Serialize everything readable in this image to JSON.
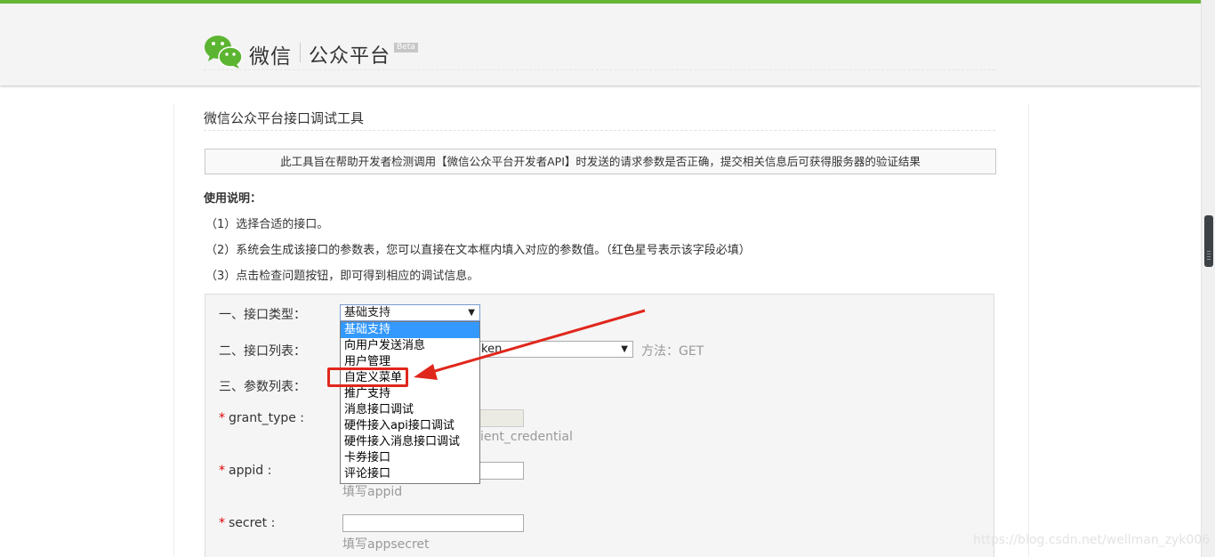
{
  "header": {
    "brand": "微信",
    "brand_sub": "公众平台",
    "beta": "Beta"
  },
  "page": {
    "title": "微信公众平台接口调试工具",
    "notice": "此工具旨在帮助开发者检测调用【微信公众平台开发者API】时发送的请求参数是否正确，提交相关信息后可获得服务器的验证结果",
    "usage_title": "使用说明：",
    "usage_items": [
      "（1）选择合适的接口。",
      "（2）系统会生成该接口的参数表，您可以直接在文本框内填入对应的参数值。（红色星号表示该字段必填）",
      "（3）点击检查问题按钮，即可得到相应的调试信息。"
    ]
  },
  "form": {
    "type_label": "一、接口类型：",
    "type_value": "基础支持",
    "list_label": "二、接口列表：",
    "list_value_partial": "ken",
    "method": "方法：GET",
    "params_label": "三、参数列表：",
    "params": [
      {
        "name": "grant_type :",
        "required": "*",
        "hint_partial": "ient_credential"
      },
      {
        "name": "appid :",
        "required": "*",
        "hint": "填写appid"
      },
      {
        "name": "secret :",
        "required": "*",
        "hint": "填写appsecret"
      }
    ]
  },
  "dropdown": {
    "options": [
      "基础支持",
      "向用户发送消息",
      "用户管理",
      "自定义菜单",
      "推广支持",
      "消息接口调试",
      "硬件接入api接口调试",
      "硬件接入消息接口调试",
      "卡券接口",
      "评论接口"
    ],
    "selected_index": 0,
    "highlighted_option": "自定义菜单"
  },
  "annotation_color": "#e0271c",
  "brand_color": "#66b535",
  "watermark": "https://blog.csdn.net/wellman_zyk006"
}
